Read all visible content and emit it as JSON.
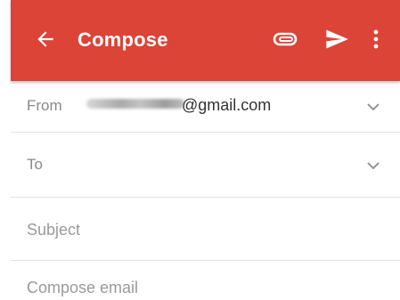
{
  "toolbar": {
    "title": "Compose",
    "background_color": "#db4437",
    "icons": {
      "back": "arrow-back-icon",
      "attach": "paperclip-icon",
      "send": "send-icon",
      "menu": "more-vertical-icon"
    }
  },
  "form": {
    "from_label": "From",
    "from_email_domain": "@gmail.com",
    "to_label": "To",
    "subject_placeholder": "Subject",
    "body_placeholder": "Compose email"
  }
}
